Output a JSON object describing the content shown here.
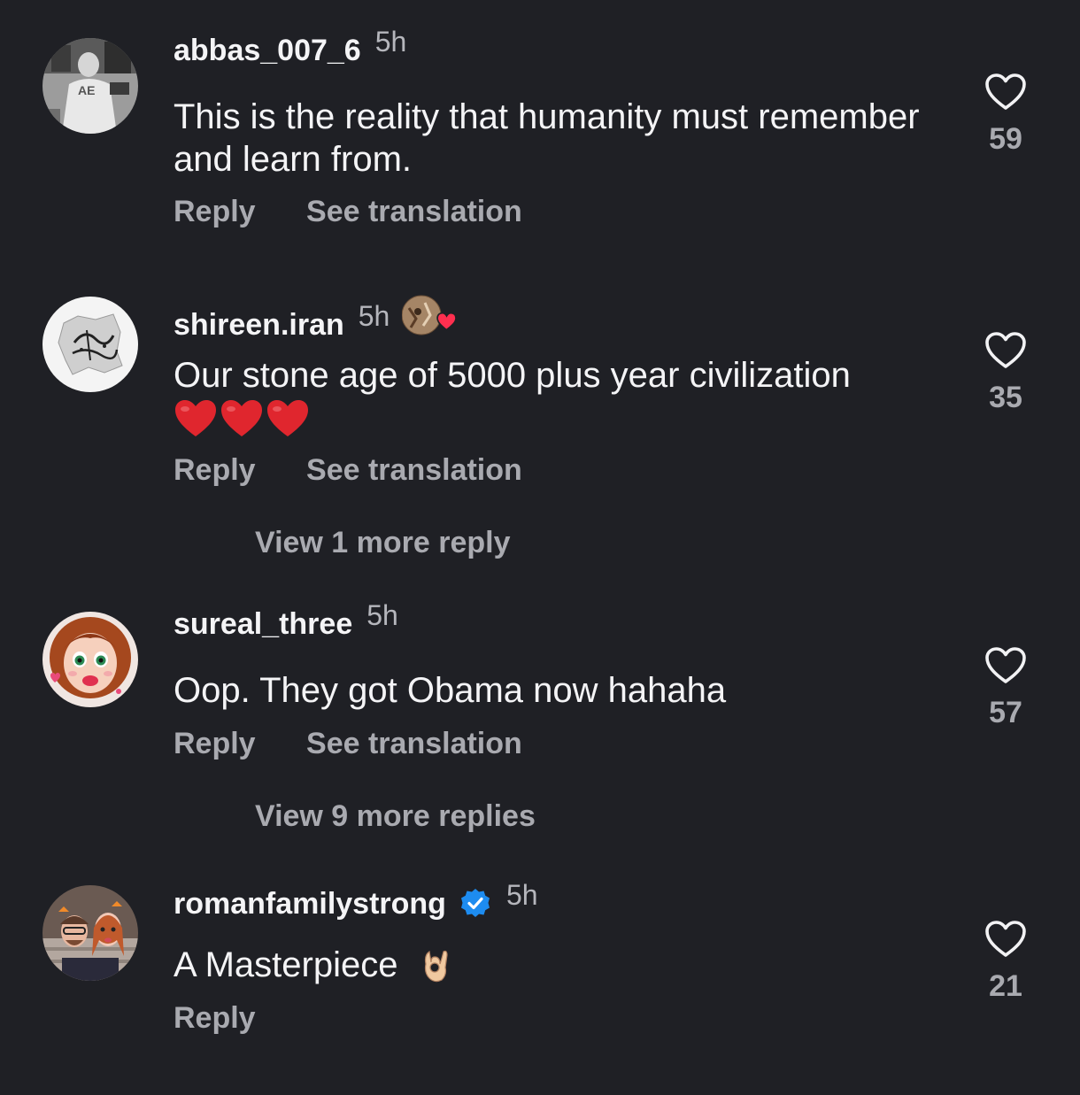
{
  "comments": [
    {
      "username": "abbas_007_6",
      "time": "5h",
      "text": "This is the reality that humanity must remember and learn from.",
      "reply_label": "Reply",
      "translate_label": "See translation",
      "likes": "59",
      "avatar_icon": "user-photo-avatar"
    },
    {
      "username": "shireen.iran",
      "time": "5h",
      "text": "Our stone age of 5000 plus year civilization",
      "emoji": "❤️❤️❤️",
      "reply_label": "Reply",
      "translate_label": "See translation",
      "view_more": "View 1 more reply",
      "likes": "35",
      "avatar_icon": "calligraphy-map-avatar"
    },
    {
      "username": "sureal_three",
      "time": "5h",
      "text": "Oop. They got Obama now hahaha",
      "reply_label": "Reply",
      "translate_label": "See translation",
      "view_more": "View 9 more replies",
      "likes": "57",
      "avatar_icon": "cartoon-girl-avatar"
    },
    {
      "username": "romanfamilystrong",
      "time": "5h",
      "text": "A Masterpiece",
      "emoji": "👌🏼",
      "reply_label": "Reply",
      "likes": "21",
      "verified": true,
      "avatar_icon": "couple-photo-avatar"
    }
  ],
  "colors": {
    "background": "#1f2025",
    "primary_text": "#f4f4f6",
    "secondary_text": "#a9aab0",
    "verified_badge": "#1d8cf0",
    "emoji_heart": "#e0262e"
  }
}
